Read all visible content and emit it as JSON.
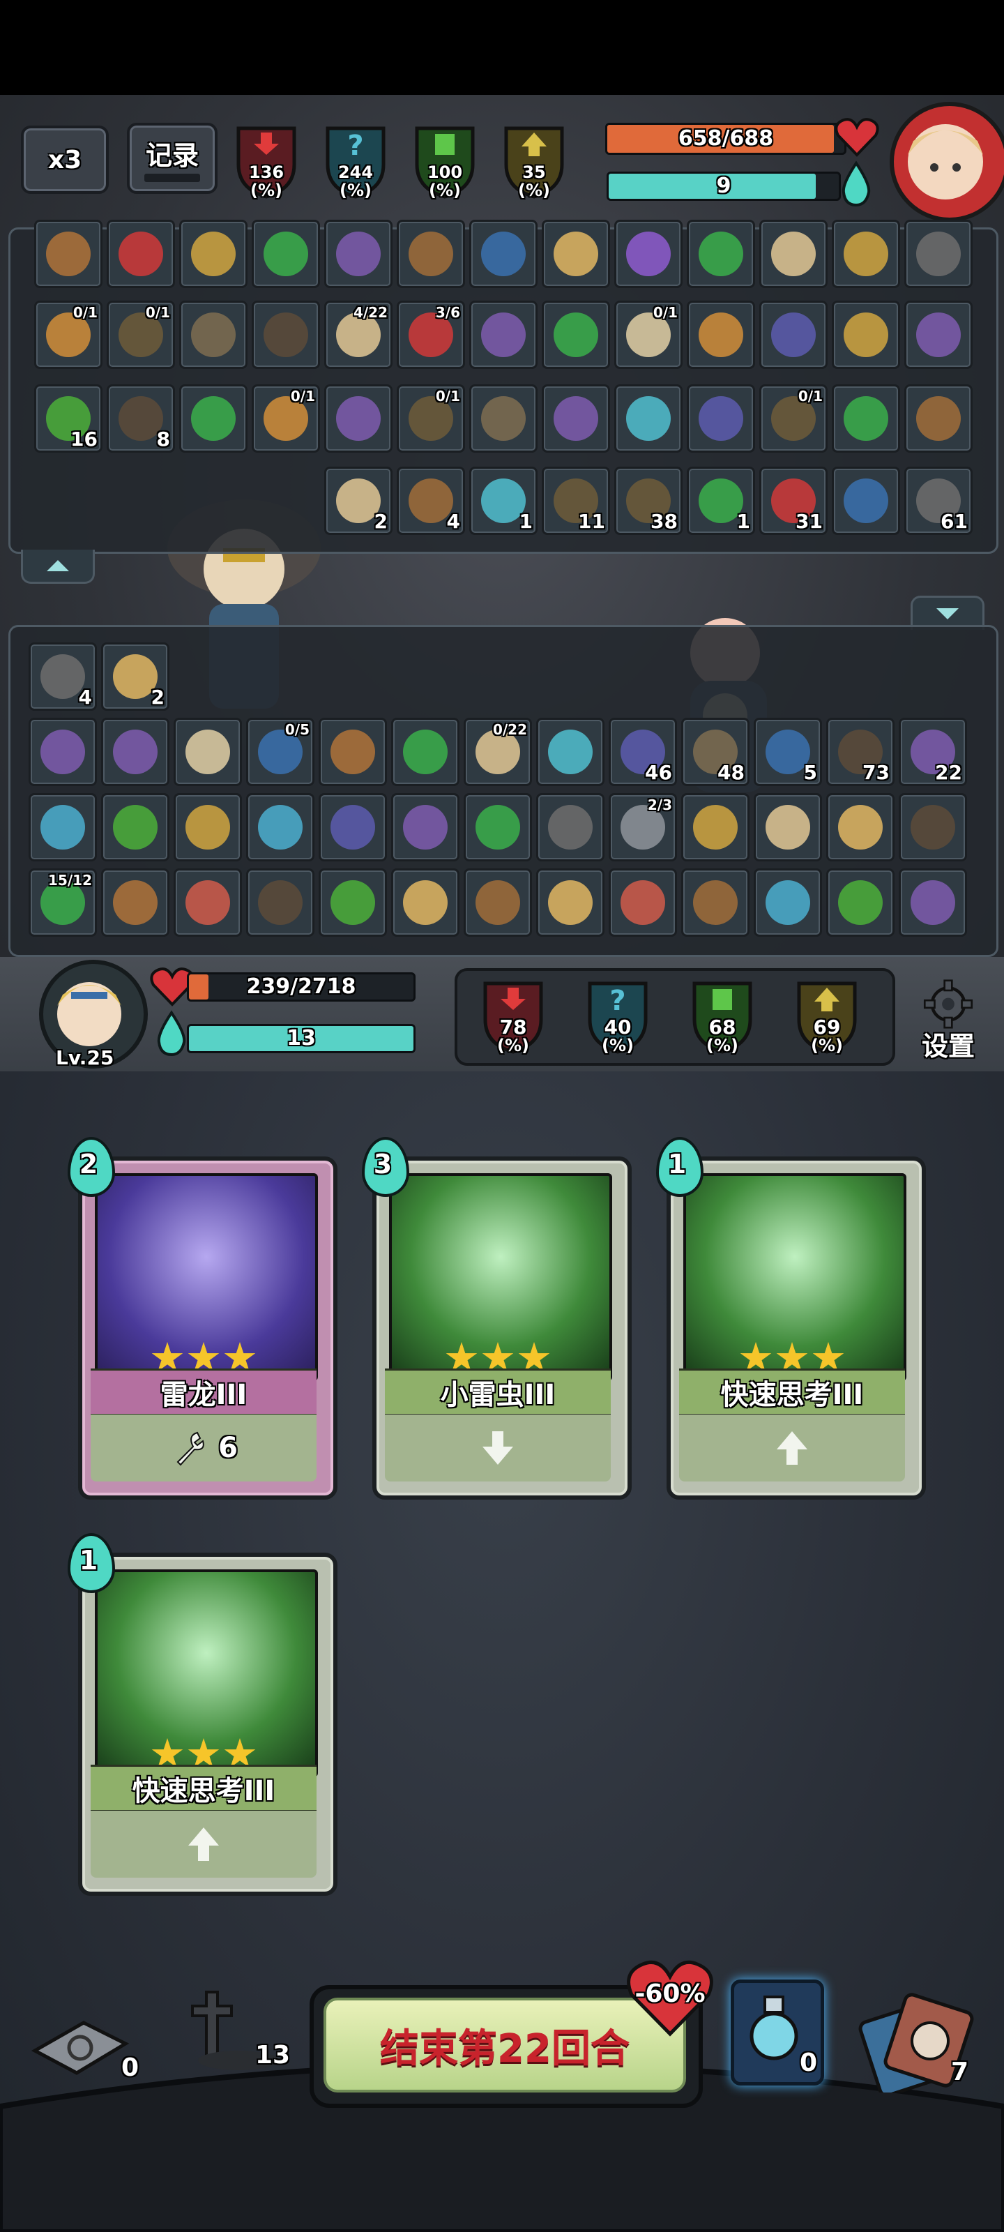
{
  "header": {
    "speed_label": "x3",
    "record_label": "记录",
    "enemy_stats": [
      {
        "value": "136",
        "unit": "(%)",
        "color": "#c8303a",
        "icon": "attack-down-arrow-icon"
      },
      {
        "value": "244",
        "unit": "(%)",
        "color": "#3a9bb0",
        "icon": "question-mark-icon"
      },
      {
        "value": "100",
        "unit": "(%)",
        "color": "#4aa83a",
        "icon": "shield-up-icon"
      },
      {
        "value": "35",
        "unit": "(%)",
        "color": "#b8a23a",
        "icon": "arrow-up-icon"
      }
    ],
    "enemy_hp": "658/688",
    "enemy_hp_fraction": 0.956,
    "enemy_mana": "9",
    "enemy_mana_fraction": 0.9
  },
  "enemy_panel": {
    "row1": [
      {
        "icon": "wrench-icon"
      },
      {
        "icon": "rainbow-ring-icon"
      },
      {
        "icon": "wooden-shield-icon"
      },
      {
        "icon": "green-book-icon"
      },
      {
        "icon": "scroll-icon"
      },
      {
        "icon": "wing-icon"
      },
      {
        "icon": "hourglass-icon"
      },
      {
        "icon": "red-glove-icon"
      },
      {
        "icon": "round-shield-icon"
      },
      {
        "icon": "pouch-icon"
      },
      {
        "icon": "owl-icon"
      },
      {
        "icon": "wooden-shield-icon"
      },
      {
        "icon": "helmet-icon"
      }
    ],
    "row2": [
      {
        "icon": "lantern-icon",
        "progress": "0/1"
      },
      {
        "icon": "blue-shield-icon",
        "progress": "0/1"
      },
      {
        "icon": "water-ripple-icon"
      },
      {
        "icon": "rune-stone-icon"
      },
      {
        "icon": "turtle-icon",
        "progress": "4/22"
      },
      {
        "icon": "scroll-sheet-icon",
        "progress": "3/6"
      },
      {
        "icon": "green-swirl-icon"
      },
      {
        "icon": "meat-icon"
      },
      {
        "icon": "boomerang-icon",
        "progress": "0/1"
      },
      {
        "icon": "vortex-icon"
      },
      {
        "icon": "crystal-icon"
      },
      {
        "icon": "wooden-shield-icon"
      },
      {
        "icon": "broom-icon"
      }
    ],
    "row3": [
      {
        "icon": "serpent-icon",
        "count": "16"
      },
      {
        "icon": "lightning-icon",
        "count": "8"
      },
      {
        "icon": "fire-figure-icon"
      },
      {
        "icon": "lantern-icon",
        "progress": "0/1"
      },
      {
        "icon": "star-burst-icon"
      },
      {
        "icon": "blue-shield-icon",
        "progress": "0/1"
      },
      {
        "icon": "water-ripple-icon"
      },
      {
        "icon": "ice-gem-icon"
      },
      {
        "icon": "spiral-icon"
      },
      {
        "icon": "purple-gem-icon"
      },
      {
        "icon": "blue-shield-icon",
        "progress": "0/1"
      },
      {
        "icon": "fire-figure-icon"
      },
      {
        "icon": "hex-crystal-icon"
      }
    ],
    "buffs": [
      {
        "icon": "bone-icon",
        "count": "2"
      },
      {
        "icon": "wing-boot-icon",
        "count": "4"
      },
      {
        "icon": "crescent-moon-icon",
        "count": "1"
      },
      {
        "icon": "blue-shield-icon",
        "count": "11"
      },
      {
        "icon": "drops-icon",
        "count": "38"
      },
      {
        "icon": "green-sprout-icon",
        "count": "1"
      },
      {
        "icon": "red-flame-icon",
        "count": "31"
      },
      {
        "icon": "eye-figure-icon",
        "count": ""
      },
      {
        "icon": "candle-icon",
        "count": "61"
      }
    ]
  },
  "player_panel": {
    "buffs": [
      {
        "icon": "green-dragon-icon",
        "count": "4"
      },
      {
        "icon": "sword-icon",
        "count": "2"
      }
    ],
    "row1": [
      {
        "icon": "broom-icon"
      },
      {
        "icon": "egg-icon"
      },
      {
        "icon": "gauntlet-icon"
      },
      {
        "icon": "ring-icon",
        "progress": "0/5"
      },
      {
        "icon": "wrench-icon"
      },
      {
        "icon": "pouch-icon"
      },
      {
        "icon": "turtle-icon",
        "progress": "0/22"
      },
      {
        "icon": "gear-gem-icon"
      },
      {
        "icon": "green-blade-icon",
        "count": "46"
      },
      {
        "icon": "purple-orb-icon",
        "count": "48"
      },
      {
        "icon": "stone-die-icon",
        "count": "5"
      },
      {
        "icon": "snowflake-icon",
        "count": "73"
      },
      {
        "icon": "skull-icon",
        "count": "22"
      }
    ],
    "row2": [
      {
        "icon": "golden-tome-icon"
      },
      {
        "icon": "doll-icon"
      },
      {
        "icon": "staff-icon"
      },
      {
        "icon": "mirror-icon"
      },
      {
        "icon": "crystal-icon"
      },
      {
        "icon": "scroll-icon"
      },
      {
        "icon": "pouch-icon"
      },
      {
        "icon": "fire-fruit-icon"
      },
      {
        "icon": "red-egg-icon",
        "progress": "2/3"
      },
      {
        "icon": "red-imp-icon"
      },
      {
        "icon": "owl-icon"
      },
      {
        "icon": "golden-glove-icon"
      },
      {
        "icon": "bomb-icon"
      }
    ],
    "row3": [
      {
        "icon": "feather-icon",
        "progress": "15/12"
      },
      {
        "icon": "spear-icon"
      },
      {
        "icon": "branch-icon"
      },
      {
        "icon": "skull-rune-icon"
      },
      {
        "icon": "dome-icon"
      },
      {
        "icon": "star-rune-icon"
      },
      {
        "icon": "orange-loop-icon"
      },
      {
        "icon": "orange-tree-icon"
      },
      {
        "icon": "red-tree-icon"
      },
      {
        "icon": "orange-loop-icon"
      },
      {
        "icon": "hero-figure-icon"
      },
      {
        "icon": "rice-ball-icon"
      },
      {
        "icon": "roast-icon"
      }
    ]
  },
  "player": {
    "level": "Lv.25",
    "hp": "239/2718",
    "hp_fraction": 0.088,
    "mana": "13",
    "mana_fraction": 1.0,
    "stats": [
      {
        "value": "78",
        "unit": "(%)",
        "color": "#c8303a",
        "icon": "attack-down-arrow-icon"
      },
      {
        "value": "40",
        "unit": "(%)",
        "color": "#3a9bb0",
        "icon": "question-mark-icon"
      },
      {
        "value": "68",
        "unit": "(%)",
        "color": "#4aa83a",
        "icon": "shield-up-icon"
      },
      {
        "value": "69",
        "unit": "(%)",
        "color": "#b8a23a",
        "icon": "arrow-up-icon"
      }
    ],
    "settings_label": "设置"
  },
  "hand": [
    {
      "name": "雷龙III",
      "cost": "2",
      "footer": "6",
      "footer_icon": "wrench-icon",
      "rarity": "purple"
    },
    {
      "name": "小雷虫III",
      "cost": "3",
      "footer": "",
      "footer_icon": "down-arrow-icon",
      "rarity": "green"
    },
    {
      "name": "快速思考III",
      "cost": "1",
      "footer": "",
      "footer_icon": "up-arrow-icon",
      "rarity": "green"
    },
    {
      "name": "快速思考III",
      "cost": "1",
      "footer": "",
      "footer_icon": "up-arrow-icon",
      "rarity": "green"
    }
  ],
  "footer": {
    "discard_count": "0",
    "grave_count": "13",
    "end_turn_label": "结束第22回合",
    "discount_label": "-60%",
    "potion_count": "0",
    "deck_count": "7"
  }
}
